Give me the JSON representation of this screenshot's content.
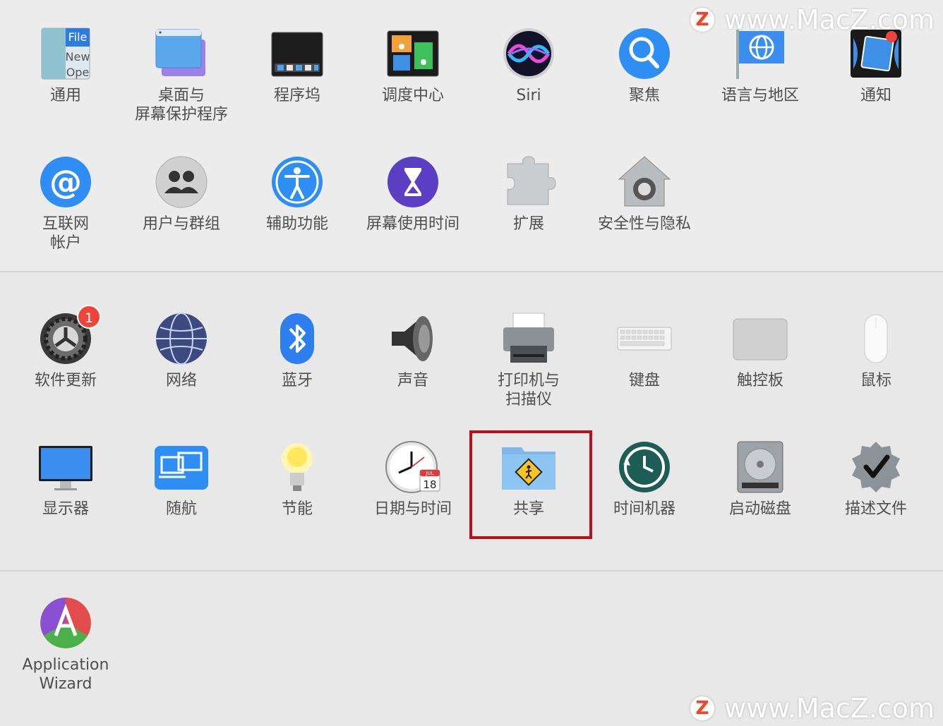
{
  "rows": {
    "row1": [
      {
        "id": "general",
        "label": "通用",
        "icon": "general-icon"
      },
      {
        "id": "desktop",
        "label": "桌面与\n屏幕保护程序",
        "icon": "desktop-screensaver-icon"
      },
      {
        "id": "dock",
        "label": "程序坞",
        "icon": "dock-icon"
      },
      {
        "id": "mission",
        "label": "调度中心",
        "icon": "mission-control-icon"
      },
      {
        "id": "siri",
        "label": "Siri",
        "icon": "siri-icon"
      },
      {
        "id": "spotlight",
        "label": "聚焦",
        "icon": "spotlight-icon"
      },
      {
        "id": "language",
        "label": "语言与地区",
        "icon": "language-region-icon"
      },
      {
        "id": "notifications",
        "label": "通知",
        "icon": "notifications-icon"
      }
    ],
    "row2": [
      {
        "id": "internet",
        "label": "互联网\n帐户",
        "icon": "internet-accounts-icon"
      },
      {
        "id": "users",
        "label": "用户与群组",
        "icon": "users-groups-icon"
      },
      {
        "id": "accessibility",
        "label": "辅助功能",
        "icon": "accessibility-icon"
      },
      {
        "id": "screentime",
        "label": "屏幕使用时间",
        "icon": "screen-time-icon"
      },
      {
        "id": "extensions",
        "label": "扩展",
        "icon": "extensions-icon"
      },
      {
        "id": "security",
        "label": "安全性与隐私",
        "icon": "security-privacy-icon"
      }
    ],
    "row3": [
      {
        "id": "update",
        "label": "软件更新",
        "icon": "software-update-icon",
        "badge": "1"
      },
      {
        "id": "network",
        "label": "网络",
        "icon": "network-icon"
      },
      {
        "id": "bluetooth",
        "label": "蓝牙",
        "icon": "bluetooth-icon"
      },
      {
        "id": "sound",
        "label": "声音",
        "icon": "sound-icon"
      },
      {
        "id": "printers",
        "label": "打印机与\n扫描仪",
        "icon": "printers-scanners-icon"
      },
      {
        "id": "keyboard",
        "label": "键盘",
        "icon": "keyboard-icon"
      },
      {
        "id": "trackpad",
        "label": "触控板",
        "icon": "trackpad-icon"
      },
      {
        "id": "mouse",
        "label": "鼠标",
        "icon": "mouse-icon"
      }
    ],
    "row4": [
      {
        "id": "displays",
        "label": "显示器",
        "icon": "displays-icon"
      },
      {
        "id": "sidecar",
        "label": "随航",
        "icon": "sidecar-icon"
      },
      {
        "id": "energy",
        "label": "节能",
        "icon": "energy-saver-icon"
      },
      {
        "id": "datetime",
        "label": "日期与时间",
        "icon": "date-time-icon",
        "cal_month": "JUL",
        "cal_day": "18"
      },
      {
        "id": "sharing",
        "label": "共享",
        "icon": "sharing-icon",
        "highlighted": true
      },
      {
        "id": "timemachine",
        "label": "时间机器",
        "icon": "time-machine-icon"
      },
      {
        "id": "startup",
        "label": "启动磁盘",
        "icon": "startup-disk-icon"
      },
      {
        "id": "profiles",
        "label": "描述文件",
        "icon": "profiles-icon"
      }
    ],
    "row5": [
      {
        "id": "appwizard",
        "label": "Application\nWizard",
        "icon": "application-wizard-icon"
      }
    ]
  },
  "general_icon_text": [
    "File",
    "New",
    "Ope"
  ],
  "watermark": {
    "text": "www.MacZ.com",
    "logo": "Z"
  },
  "colors": {
    "highlight": "#b5121b",
    "badge": "#f0443b",
    "accent": "#2f8ef3"
  }
}
